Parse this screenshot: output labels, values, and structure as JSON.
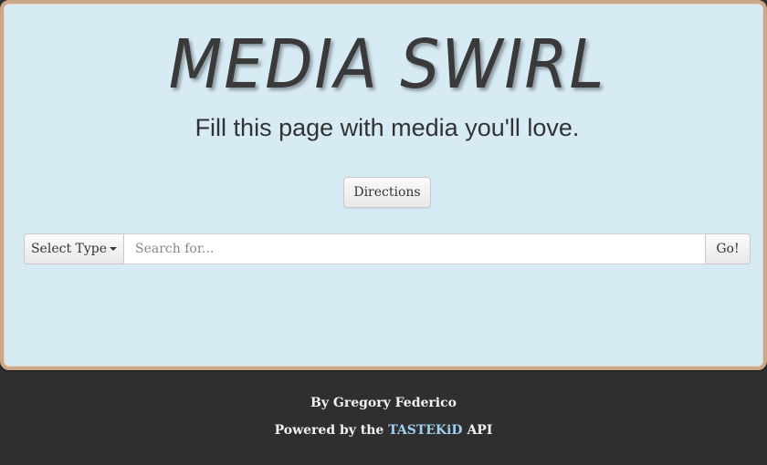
{
  "header": {
    "title": "MEDIA SWIRL",
    "subtitle": "Fill this page with media you'll love."
  },
  "actions": {
    "directions_label": "Directions"
  },
  "search": {
    "type_label": "Select Type",
    "placeholder": "Search for...",
    "value": "",
    "go_label": "Go!"
  },
  "footer": {
    "byline": "By Gregory Federico",
    "powered_prefix": "Powered by the",
    "api_name": "TASTEKiD",
    "powered_suffix": "API"
  },
  "colors": {
    "panel_bg": "#d7ebf5",
    "panel_border": "#c9a98a",
    "footer_bg": "#2f2f2f",
    "link": "#9fcfef"
  },
  "icons": {
    "type_dropdown": "caret-down-icon"
  }
}
